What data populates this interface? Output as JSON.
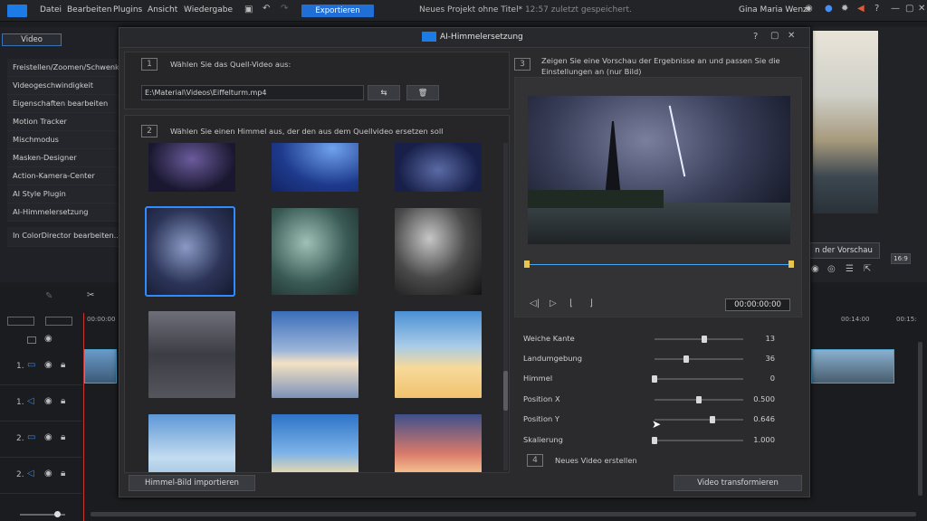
{
  "menubar": {
    "items": [
      "Datei",
      "Bearbeiten",
      "Plugins",
      "Ansicht",
      "Wiedergabe"
    ],
    "export_label": "Exportieren",
    "project_title": "Neues Projekt ohne Titel*",
    "project_saved": "12:57 zuletzt gespeichert.",
    "user_name": "Gina Maria Wenz"
  },
  "left_panel": {
    "tab": "Video",
    "items": [
      "Freistellen/Zoomen/Schwenken",
      "Videogeschwindigkeit",
      "Eigenschaften bearbeiten",
      "Motion Tracker",
      "Mischmodus",
      "Masken-Designer",
      "Action-Kamera-Center",
      "AI Style Plugin",
      "AI-Himmelersetzung",
      "In ColorDirector bearbeiten..."
    ]
  },
  "right_panel": {
    "preview_btn": "n der Vorschau",
    "ratio": "16:9"
  },
  "timeline": {
    "time_start": "00:00:00",
    "time_mid": "00:14:00",
    "time_end": "00:15:",
    "tracks": [
      "1.",
      "1.",
      "2.",
      "2."
    ]
  },
  "dialog": {
    "title": "AI-Himmelersetzung",
    "step1_num": "1",
    "step1_text": "Wählen Sie das Quell-Video aus:",
    "source_path": "E:\\Material\\Videos\\Eiffelturm.mp4",
    "step2_num": "2",
    "step2_text": "Wählen Sie einen Himmel aus, der den aus dem Quellvideo ersetzen soll",
    "import_btn": "Himmel-Bild importieren",
    "step3_num": "3",
    "step3_text": "Zeigen Sie eine Vorschau der Ergebnisse an und passen Sie die Einstellungen an (nur Bild)",
    "timecode": "00:00:00:00",
    "sliders": [
      {
        "label": "Weiche Kante",
        "value": "13",
        "level": 0.56
      },
      {
        "label": "Landumgebung",
        "value": "36",
        "level": 0.36
      },
      {
        "label": "Himmel",
        "value": "0",
        "level": 0.0
      },
      {
        "label": "Position X",
        "value": "0.500",
        "level": 0.5
      },
      {
        "label": "Position Y",
        "value": "0.646",
        "level": 0.65
      },
      {
        "label": "Skalierung",
        "value": "1.000",
        "level": 0.0
      }
    ],
    "step4_num": "4",
    "step4_text": "Neues Video erstellen",
    "transform_btn": "Video transformieren"
  },
  "colors": {
    "accent": "#1f6fd6",
    "selected_border": "#2f8cff"
  }
}
